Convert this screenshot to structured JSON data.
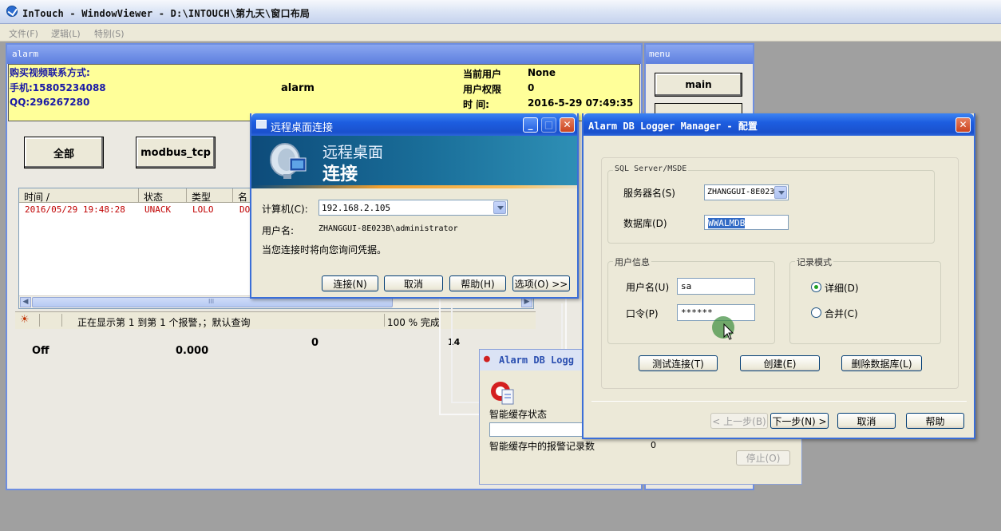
{
  "app": {
    "title": "InTouch - WindowViewer - D:\\INTOUCH\\第九天\\窗口布局",
    "menu": [
      "文件(F)",
      "逻辑(L)",
      "特别(S)"
    ]
  },
  "alarm_window": {
    "title": "alarm",
    "contact": [
      "购买视频联系方式:",
      "手机:15805234088",
      "QQ:296267280"
    ],
    "center_label": "alarm",
    "info": [
      {
        "label": "当前用户",
        "value": "None"
      },
      {
        "label": "用户权限",
        "value": "0"
      },
      {
        "label": "时    间:",
        "value": "2016-5-29 07:49:35"
      }
    ],
    "buttons": {
      "all": "全部",
      "modbus": "modbus_tcp"
    },
    "list": {
      "columns": [
        "时间 /",
        "状态",
        "类型",
        "名"
      ],
      "rows": [
        [
          "2016/05/29 19:48:28",
          "UNACK",
          "LOLO",
          "DO"
        ]
      ],
      "scroll_mark": "III"
    },
    "status": {
      "text": "正在显示第 1 到第 1 个报警，；默认查询",
      "progress": "100 % 完成"
    },
    "values": {
      "off": "Off",
      "zero_dec": "0.000",
      "zero": "0",
      "num": "14"
    }
  },
  "menu_window": {
    "title": "menu",
    "main_button": "main"
  },
  "remote_desktop": {
    "title": "远程桌面连接",
    "banner_line1": "远程桌面",
    "banner_line2": "连接",
    "computer_label": "计算机(C):",
    "computer_value": "192.168.2.105",
    "user_label": "用户名:",
    "user_value": "ZHANGGUI-8E023B\\administrator",
    "note": "当您连接时将向您询问凭据。",
    "buttons": {
      "connect": "连接(N)",
      "cancel": "取消",
      "help": "帮助(H)",
      "options": "选项(O) >>"
    }
  },
  "config_window": {
    "title": "Alarm DB Logger Manager - 配置",
    "sql_group": "SQL Server/MSDE",
    "server_label": "服务器名(S)",
    "server_value": "ZHANGGUI-8E023",
    "db_label": "数据库(D)",
    "db_value": "WWALMDB",
    "user_group": "用户信息",
    "username_label": "用户名(U)",
    "username_value": "sa",
    "password_label": "口令(P)",
    "password_value": "******",
    "mode_group": "记录模式",
    "mode_detail": "详细(D)",
    "mode_merge": "合并(C)",
    "mode_selected": "detail",
    "btn_test": "测试连接(T)",
    "btn_create": "创建(E)",
    "btn_delete": "删除数据库(L)",
    "btn_prev": "< 上一步(B)",
    "btn_next": "下一步(N) >",
    "btn_cancel": "取消",
    "btn_help": "帮助"
  },
  "logger_window": {
    "title": "Alarm DB Logg",
    "cache_status_label": "智能缓存状态",
    "cache_count_label": "智能缓存中的报警记录数",
    "cache_count": "0",
    "stop": "停止(O)"
  },
  "colors": {
    "title_blue": "#1d5ee0",
    "alarm_red": "#c00000",
    "yellow_panel": "#ffff99"
  }
}
